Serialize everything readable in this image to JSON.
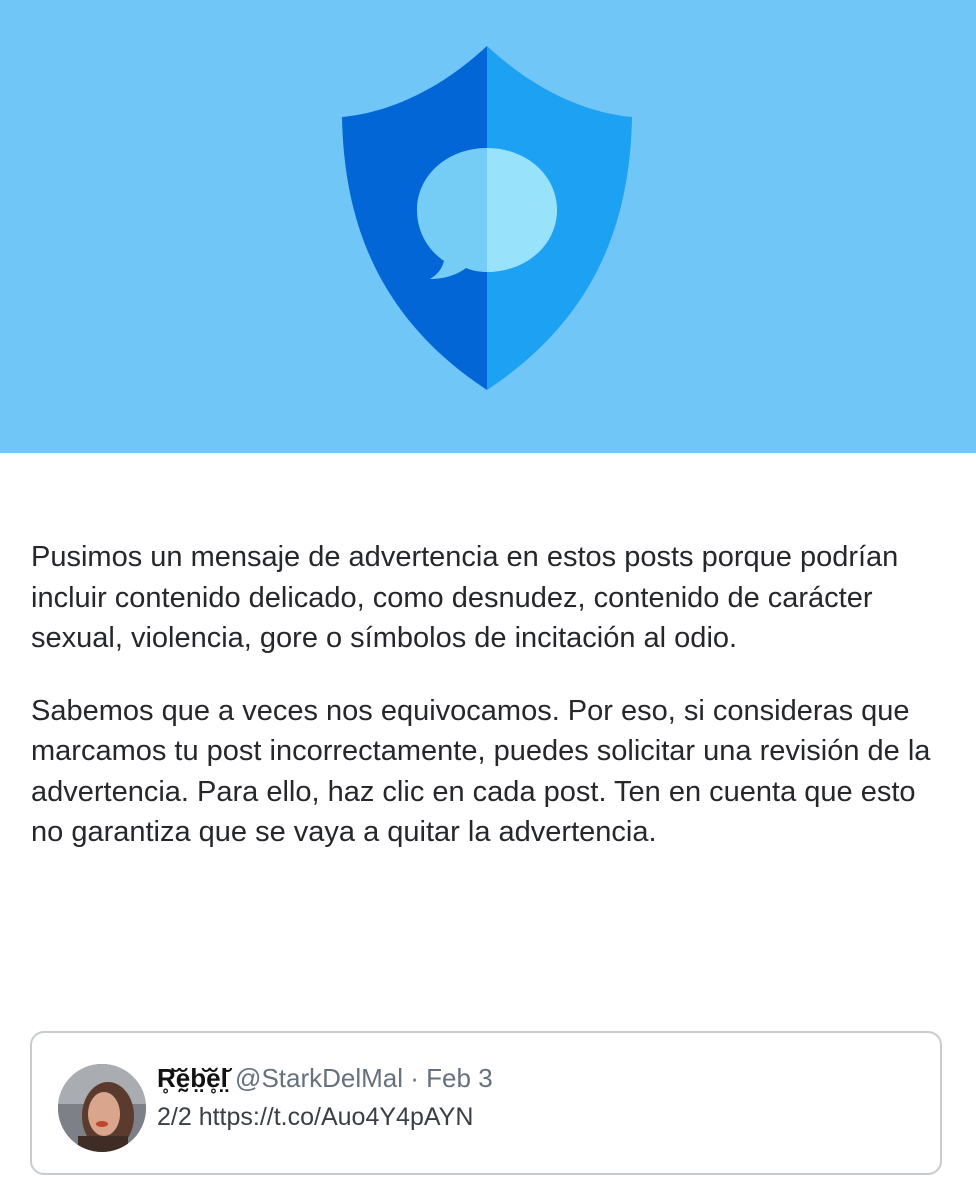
{
  "colors": {
    "hero_background": "#70c6f7",
    "shield_dark": "#0366d6",
    "shield_light": "#1da1f2",
    "bubble_dark": "#75ccf4",
    "bubble_light": "#98e2fb"
  },
  "hero": {
    "icon": "shield-speech-bubble-icon"
  },
  "notice": {
    "paragraph_1": "Pusimos un mensaje de advertencia en estos posts porque podrían incluir contenido delicado, como desnudez, contenido de carácter sexual, violencia, gore o símbolos de incitación al odio.",
    "paragraph_2": "Sabemos que a veces nos equivocamos. Por eso, si consideras que marcamos tu post incorrectamente, puedes solicitar una revisión de la advertencia. Para ello, haz clic en cada post. Ten en cuenta que esto no garantiza que se vaya a quitar la advertencia."
  },
  "tweet": {
    "display_name": "R̥̆ḛ̆b̤̆ĕ̥l̤̆",
    "handle": "@StarkDelMal",
    "separator": "·",
    "date": "Feb 3",
    "text": "2/2 https://t.co/Auo4Y4pAYN"
  }
}
